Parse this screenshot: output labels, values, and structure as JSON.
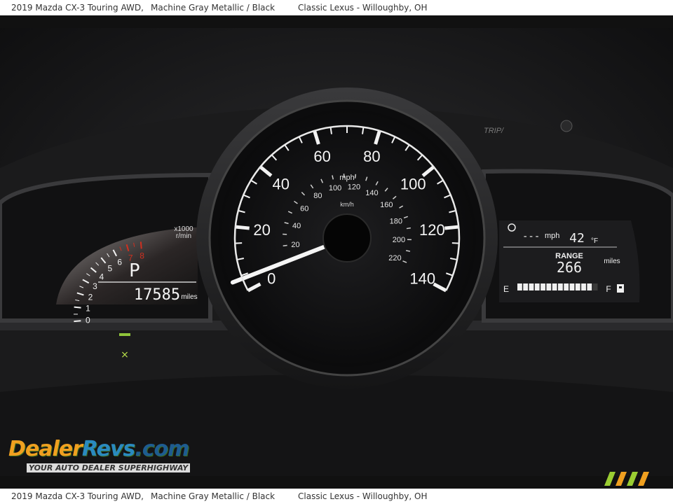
{
  "caption": {
    "vehicle": "2019 Mazda CX-3 Touring AWD,",
    "color": "Machine Gray Metallic / Black",
    "dealer": "Classic Lexus - Willoughby, OH"
  },
  "speedometer": {
    "mph_labels": [
      "0",
      "20",
      "40",
      "60",
      "80",
      "100",
      "120",
      "140"
    ],
    "kmh_labels": [
      "20",
      "40",
      "60",
      "80",
      "100",
      "120",
      "140",
      "160",
      "180",
      "200",
      "220"
    ],
    "mph_unit": "mph",
    "kmh_unit": "km/h",
    "needle_mph": 4
  },
  "tachometer": {
    "labels": [
      "0",
      "1",
      "2",
      "3",
      "4",
      "5",
      "6",
      "7",
      "8"
    ],
    "unit_top": "x1000",
    "unit_bottom": "r/min",
    "gear": "P",
    "odometer": "17585",
    "odometer_unit": "miles"
  },
  "info_display": {
    "speed": "---",
    "speed_unit": "mph",
    "temperature": "42",
    "temperature_unit": "°F",
    "range_label": "RANGE",
    "range_value": "266",
    "range_unit": "miles",
    "fuel_empty": "E",
    "fuel_full": "F",
    "fuel_level": 0.92
  },
  "trip_button_label": "TRIP/",
  "watermark": {
    "logo_a": "Dealer",
    "logo_b": "Revs",
    "logo_c": ".com",
    "tagline": "YOUR AUTO DEALER SUPERHIGHWAY"
  },
  "colors": {
    "dial_white": "#f2f2f2",
    "redline": "#d03020",
    "display_bg": "#1a1a1c",
    "wm_orange": "#f0a020",
    "wm_blue": "#2a8ac0"
  }
}
